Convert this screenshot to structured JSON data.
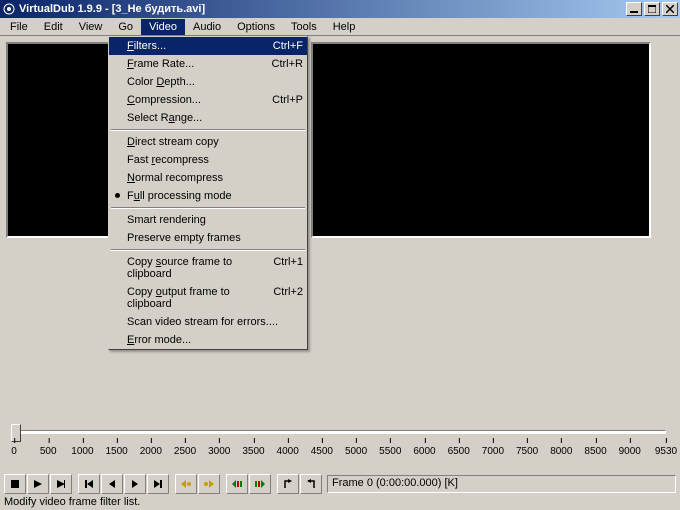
{
  "window": {
    "title": "VirtualDub 1.9.9 - [3_Не будить.avi]"
  },
  "menubar": {
    "items": [
      "File",
      "Edit",
      "View",
      "Go",
      "Video",
      "Audio",
      "Options",
      "Tools",
      "Help"
    ],
    "open_index": 4
  },
  "video_menu": {
    "groups": [
      [
        {
          "label": "Filters...",
          "shortcut": "Ctrl+F",
          "highlighted": true,
          "u": 0
        },
        {
          "label": "Frame Rate...",
          "shortcut": "Ctrl+R",
          "u": 0
        },
        {
          "label": "Color Depth...",
          "shortcut": "",
          "u": 6
        },
        {
          "label": "Compression...",
          "shortcut": "Ctrl+P",
          "u": 0
        },
        {
          "label": "Select Range...",
          "shortcut": "",
          "u": 8
        }
      ],
      [
        {
          "label": "Direct stream copy",
          "shortcut": "",
          "u": 0
        },
        {
          "label": "Fast recompress",
          "shortcut": "",
          "u": 5
        },
        {
          "label": "Normal recompress",
          "shortcut": "",
          "u": 0
        },
        {
          "label": "Full processing mode",
          "shortcut": "",
          "u": 1,
          "bullet": true
        }
      ],
      [
        {
          "label": "Smart rendering",
          "shortcut": "",
          "u": -1
        },
        {
          "label": "Preserve empty frames",
          "shortcut": "",
          "u": -1
        }
      ],
      [
        {
          "label": "Copy source frame to clipboard",
          "shortcut": "Ctrl+1",
          "u": 5
        },
        {
          "label": "Copy output frame to clipboard",
          "shortcut": "Ctrl+2",
          "u": 5
        },
        {
          "label": "Scan video stream for errors....",
          "shortcut": "",
          "u": -1
        },
        {
          "label": "Error mode...",
          "shortcut": "",
          "u": 0
        }
      ]
    ]
  },
  "ruler": {
    "ticks": [
      "0",
      "500",
      "1000",
      "1500",
      "2000",
      "2500",
      "3000",
      "3500",
      "4000",
      "4500",
      "5000",
      "5500",
      "6000",
      "6500",
      "7000",
      "7500",
      "8000",
      "8500",
      "9000",
      "9530"
    ]
  },
  "toolbar": {
    "frame_info": "Frame 0 (0:00:00.000) [K]"
  },
  "statusbar": {
    "text": "Modify video frame filter list."
  }
}
